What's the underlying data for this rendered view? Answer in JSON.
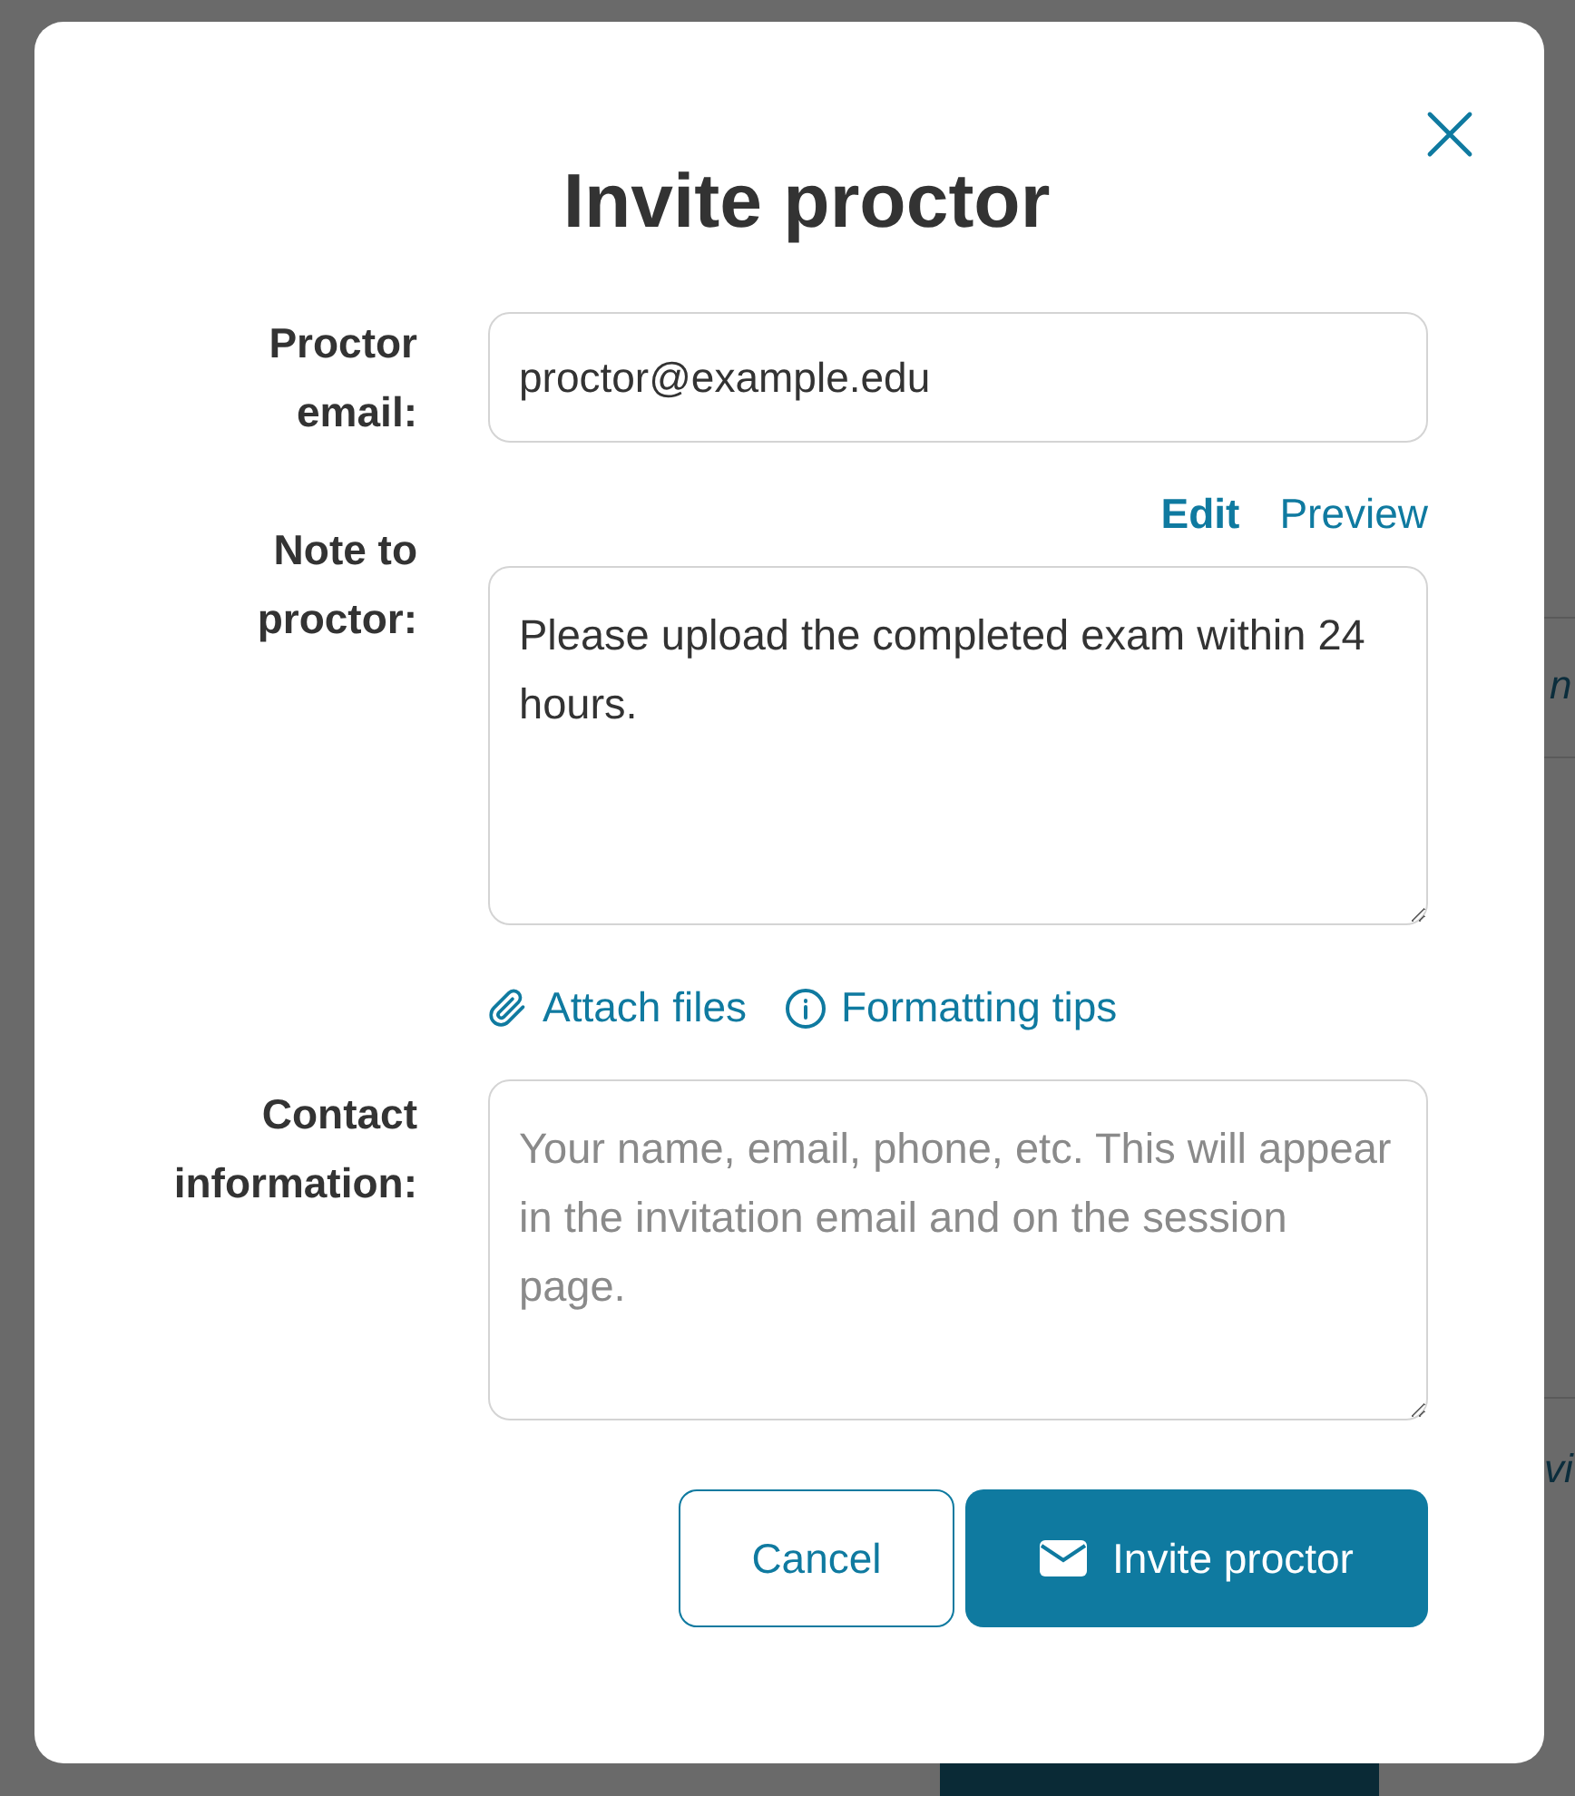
{
  "background_page": {
    "fragments": [
      "n",
      "vi"
    ]
  },
  "dialog": {
    "title": "Invite proctor"
  },
  "proctor_email": {
    "label": "Proctor email:",
    "value": "proctor@example.edu"
  },
  "note": {
    "label": "Note to proctor:",
    "tabs": [
      {
        "label": "Edit",
        "selected": true
      },
      {
        "label": "Preview",
        "selected": false
      }
    ],
    "value": "Please upload the completed exam within 24 hours.",
    "actions": [
      {
        "kind": "attach",
        "label": "Attach files"
      },
      {
        "kind": "info",
        "label": "Formatting tips"
      }
    ]
  },
  "contact": {
    "label": "Contact information:",
    "placeholder": "Your name, email, phone, etc. This will appear in the invitation email and on the session page."
  },
  "buttons": [
    {
      "kind": "secondary",
      "label": "Cancel"
    },
    {
      "kind": "primary",
      "label": "Invite proctor"
    }
  ]
}
